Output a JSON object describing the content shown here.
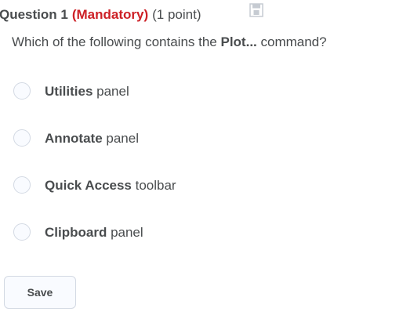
{
  "question": {
    "number_label": "Question 1",
    "mandatory_label": "(Mandatory)",
    "points_label": "(1 point)",
    "save_state_icon": "floppy-disk-icon",
    "text_before": "Which of the following contains the ",
    "text_bold": "Plot...",
    "text_after": " command?"
  },
  "options": [
    {
      "bold": "Utilities",
      "rest": " panel",
      "selected": false
    },
    {
      "bold": "Annotate",
      "rest": " panel",
      "selected": false
    },
    {
      "bold": "Quick Access",
      "rest": " toolbar",
      "selected": false
    },
    {
      "bold": "Clipboard",
      "rest": " panel",
      "selected": false
    }
  ],
  "actions": {
    "save_label": "Save"
  },
  "colors": {
    "text": "#494c4e",
    "mandatory": "#cd2026",
    "radio_border": "#d3d9e3",
    "radio_fill": "#f9fbff",
    "icon": "#c6cbd2"
  }
}
